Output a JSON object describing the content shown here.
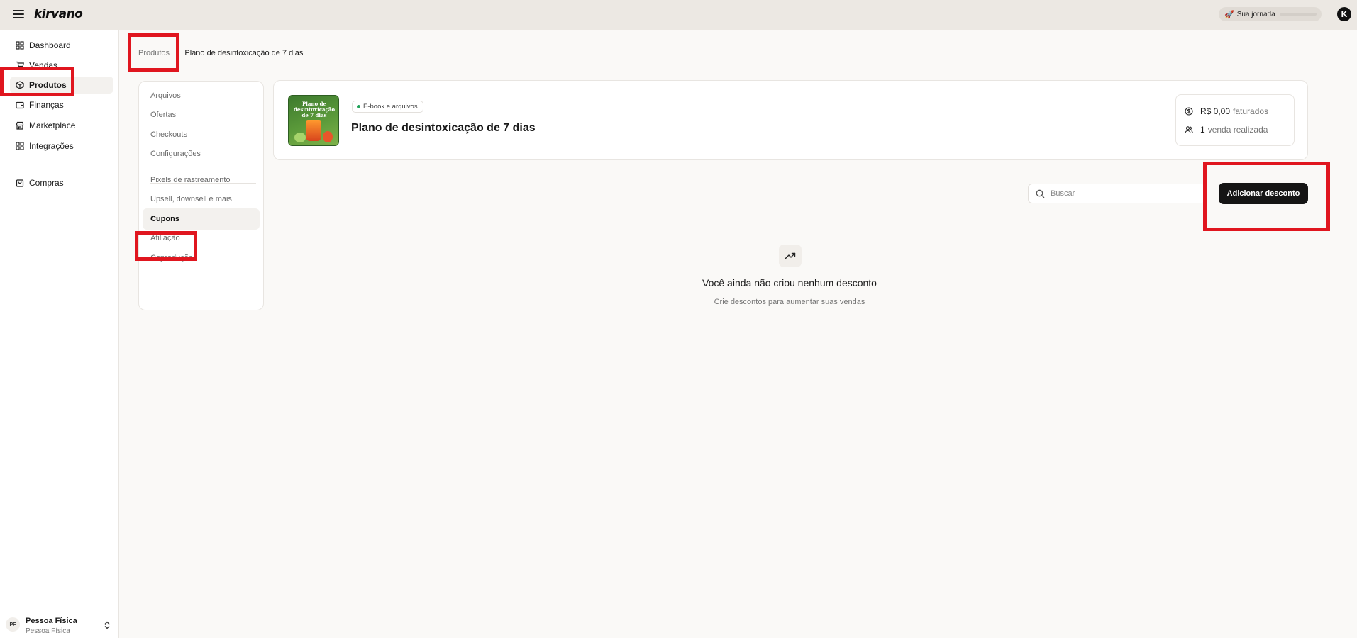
{
  "topbar": {
    "logo": "kirvano",
    "journey_label": "Sua jornada",
    "avatar_letter": "K"
  },
  "sidebar": {
    "items": [
      {
        "label": "Dashboard",
        "icon": "dashboard-icon"
      },
      {
        "label": "Vendas",
        "icon": "cart-icon"
      },
      {
        "label": "Produtos",
        "icon": "box-icon"
      },
      {
        "label": "Finanças",
        "icon": "wallet-icon"
      },
      {
        "label": "Marketplace",
        "icon": "store-icon"
      },
      {
        "label": "Integrações",
        "icon": "grid-icon"
      },
      {
        "label": "Compras",
        "icon": "bag-icon"
      }
    ],
    "active": "Produtos",
    "user": {
      "initials": "PF",
      "name": "Pessoa Física",
      "type": "Pessoa Física"
    }
  },
  "breadcrumb": {
    "parent": "Produtos",
    "separator": "›",
    "current": "Plano de desintoxicação de 7 dias"
  },
  "submenu": {
    "items": [
      "Arquivos",
      "Ofertas",
      "Checkouts",
      "Configurações",
      "Pixels de rastreamento",
      "Upsell, downsell e mais",
      "Cupons",
      "Afiliação",
      "Coprodução"
    ],
    "active": "Cupons"
  },
  "product": {
    "thumb_text_1": "Plano de",
    "thumb_text_2": "desintoxicação",
    "thumb_text_3": "de 7 dias",
    "badge": "E-book e arquivos",
    "title": "Plano de desintoxicação de 7 dias",
    "revenue_value": "R$ 0,00",
    "revenue_label": "faturados",
    "sales_value": "1",
    "sales_label": "venda realizada"
  },
  "coupons": {
    "search_placeholder": "Buscar",
    "add_button": "Adicionar desconto",
    "empty_title": "Você ainda não criou nenhum desconto",
    "empty_subtitle": "Crie descontos para aumentar suas vendas"
  },
  "colors": {
    "accent_dark": "#151515",
    "status_green": "#22a35a",
    "highlight_red": "#e0161f"
  }
}
